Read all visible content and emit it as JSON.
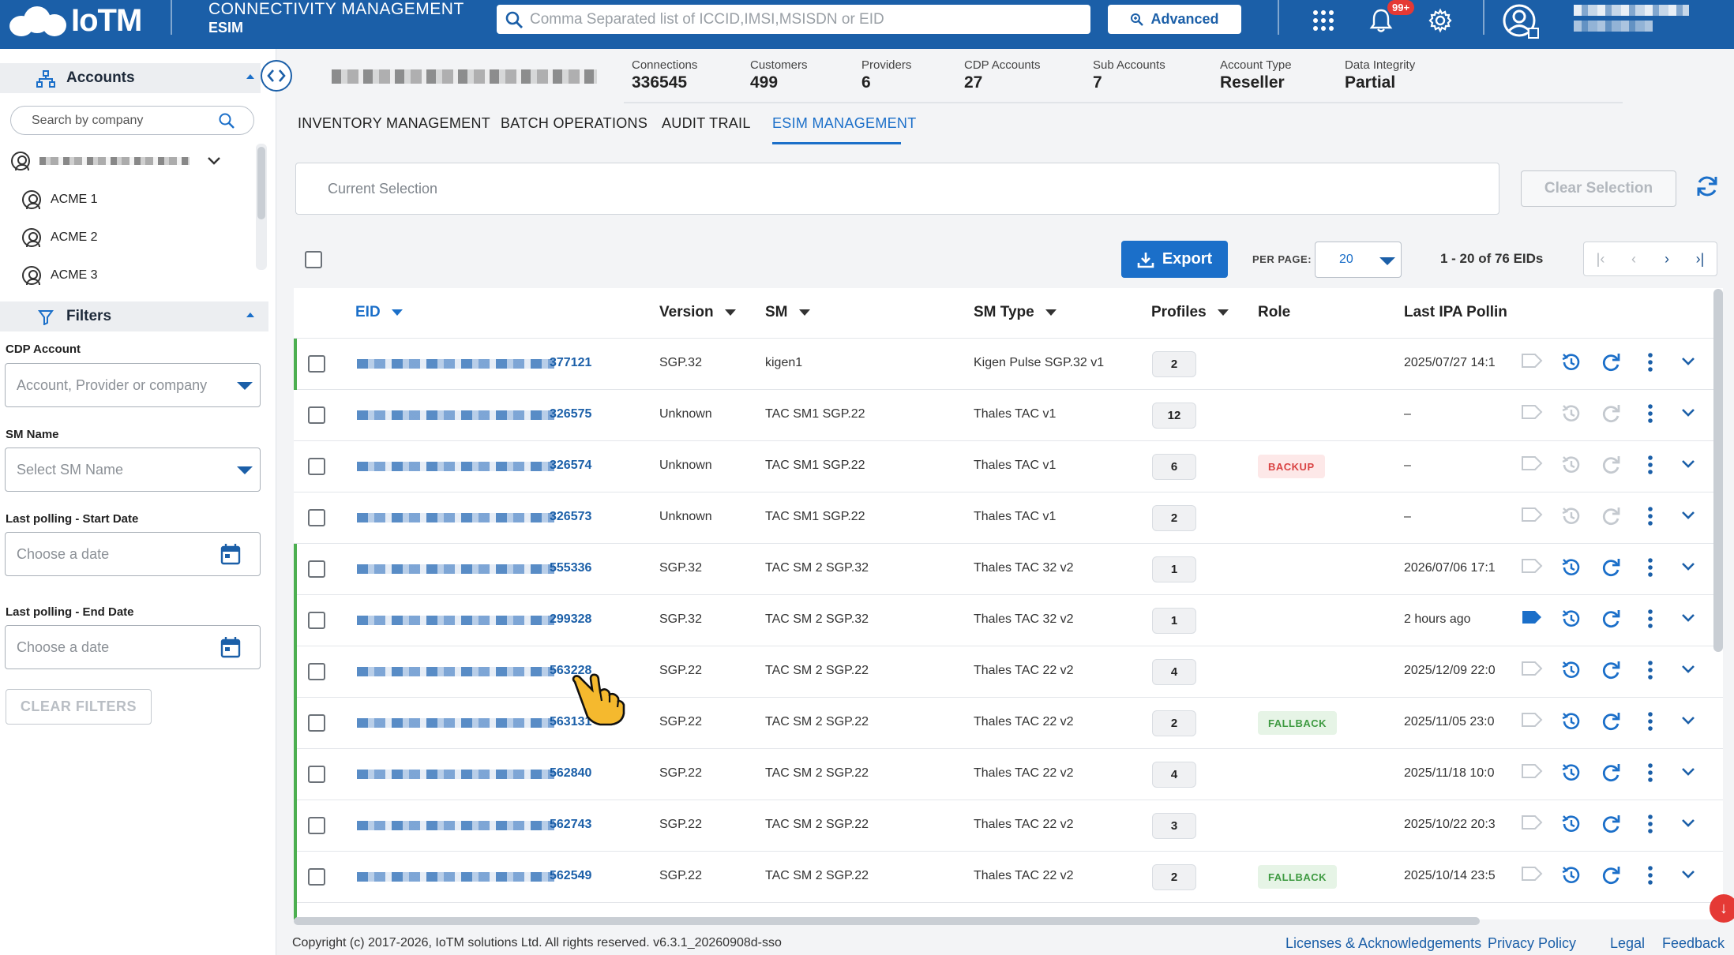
{
  "header": {
    "logo_text": "IoTM",
    "app_title": "CONNECTIVITY MANAGEMENT",
    "app_subtitle": "ESIM",
    "search_placeholder": "Comma Separated list of ICCID,IMSI,MSISDN or EID",
    "advanced_label": "Advanced",
    "notification_count": "99+"
  },
  "sidebar": {
    "accounts_label": "Accounts",
    "company_search_placeholder": "Search by company",
    "tree": [
      {
        "label": "ACME 1"
      },
      {
        "label": "ACME 2"
      },
      {
        "label": "ACME 3"
      }
    ],
    "filters_label": "Filters",
    "filters": {
      "cdp_account_label": "CDP Account",
      "cdp_account_placeholder": "Account, Provider or company",
      "sm_name_label": "SM Name",
      "sm_name_placeholder": "Select SM Name",
      "start_date_label": "Last polling - Start Date",
      "start_date_placeholder": "Choose a date",
      "end_date_label": "Last polling - End Date",
      "end_date_placeholder": "Choose a date",
      "clear_label": "CLEAR FILTERS"
    }
  },
  "stats": [
    {
      "key": "Connections",
      "value": "336545"
    },
    {
      "key": "Customers",
      "value": "499"
    },
    {
      "key": "Providers",
      "value": "6"
    },
    {
      "key": "CDP Accounts",
      "value": "27"
    },
    {
      "key": "Sub Accounts",
      "value": "7"
    },
    {
      "key": "Account Type",
      "value": "Reseller"
    },
    {
      "key": "Data Integrity",
      "value": "Partial"
    }
  ],
  "tabs": [
    {
      "label": "INVENTORY MANAGEMENT"
    },
    {
      "label": "BATCH OPERATIONS"
    },
    {
      "label": "AUDIT TRAIL"
    },
    {
      "label": "ESIM MANAGEMENT"
    }
  ],
  "selection": {
    "current_placeholder": "Current Selection",
    "clear_label": "Clear Selection"
  },
  "toolbar": {
    "export_label": "Export",
    "per_page_label": "PER PAGE:",
    "per_page_value": "20",
    "range_text": "1 - 20 of 76 EIDs"
  },
  "table": {
    "columns": {
      "eid": "EID",
      "version": "Version",
      "sm": "SM",
      "sm_type": "SM Type",
      "profiles": "Profiles",
      "role": "Role",
      "last_ipa": "Last IPA Pollin"
    },
    "rows": [
      {
        "eid": "377121",
        "version": "SGP.32",
        "sm": "kigen1",
        "sm_type": "Kigen Pulse SGP.32 v1",
        "profiles": "2",
        "role": "",
        "last_polling": "2025/07/27 14:1",
        "active": true,
        "tag_filled": false
      },
      {
        "eid": "326575",
        "version": "Unknown",
        "sm": "TAC SM1 SGP.22",
        "sm_type": "Thales TAC v1",
        "profiles": "12",
        "role": "",
        "last_polling": "–",
        "active": false,
        "tag_filled": false
      },
      {
        "eid": "326574",
        "version": "Unknown",
        "sm": "TAC SM1 SGP.22",
        "sm_type": "Thales TAC v1",
        "profiles": "6",
        "role": "BACKUP",
        "last_polling": "–",
        "active": false,
        "tag_filled": false
      },
      {
        "eid": "326573",
        "version": "Unknown",
        "sm": "TAC SM1 SGP.22",
        "sm_type": "Thales TAC v1",
        "profiles": "2",
        "role": "",
        "last_polling": "–",
        "active": false,
        "tag_filled": false
      },
      {
        "eid": "555336",
        "version": "SGP.32",
        "sm": "TAC SM 2 SGP.32",
        "sm_type": "Thales TAC 32 v2",
        "profiles": "1",
        "role": "",
        "last_polling": "2026/07/06 17:1",
        "active": true,
        "tag_filled": false
      },
      {
        "eid": "299328",
        "version": "SGP.32",
        "sm": "TAC SM 2 SGP.32",
        "sm_type": "Thales TAC 32 v2",
        "profiles": "1",
        "role": "",
        "last_polling": "2 hours ago",
        "active": true,
        "tag_filled": true
      },
      {
        "eid": "563228",
        "version": "SGP.22",
        "sm": "TAC SM 2 SGP.22",
        "sm_type": "Thales TAC 22 v2",
        "profiles": "4",
        "role": "",
        "last_polling": "2025/12/09 22:0",
        "active": true,
        "tag_filled": false
      },
      {
        "eid": "563131",
        "version": "SGP.22",
        "sm": "TAC SM 2 SGP.22",
        "sm_type": "Thales TAC 22 v2",
        "profiles": "2",
        "role": "FALLBACK",
        "last_polling": "2025/11/05 23:0",
        "active": true,
        "tag_filled": false
      },
      {
        "eid": "562840",
        "version": "SGP.22",
        "sm": "TAC SM 2 SGP.22",
        "sm_type": "Thales TAC 22 v2",
        "profiles": "4",
        "role": "",
        "last_polling": "2025/11/18 10:0",
        "active": true,
        "tag_filled": false
      },
      {
        "eid": "562743",
        "version": "SGP.22",
        "sm": "TAC SM 2 SGP.22",
        "sm_type": "Thales TAC 22 v2",
        "profiles": "3",
        "role": "",
        "last_polling": "2025/10/22 20:3",
        "active": true,
        "tag_filled": false
      },
      {
        "eid": "562549",
        "version": "SGP.22",
        "sm": "TAC SM 2 SGP.22",
        "sm_type": "Thales TAC 22 v2",
        "profiles": "2",
        "role": "FALLBACK",
        "last_polling": "2025/10/14 23:5",
        "active": true,
        "tag_filled": false
      }
    ]
  },
  "footer": {
    "copyright": "Copyright (c) 2017-2026, IoTM solutions Ltd. All rights reserved. v6.3.1_20260908d-sso",
    "links": [
      {
        "label": "Licenses & Acknowledgements"
      },
      {
        "label": "Privacy Policy"
      },
      {
        "label": "Legal"
      },
      {
        "label": "Feedback"
      }
    ]
  },
  "colors": {
    "primary": "#1b5fa8",
    "accent": "#1b6fc9",
    "active_row_bar": "#4caf50",
    "backup": "#d94343",
    "fallback": "#3e9a41"
  }
}
